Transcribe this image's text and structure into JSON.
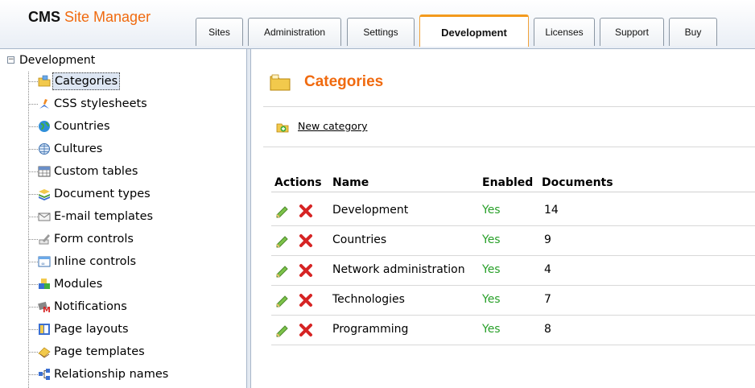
{
  "header": {
    "logo_primary": "CMS",
    "logo_secondary": "Site Manager",
    "tabs": [
      {
        "label": "Sites"
      },
      {
        "label": "Administration"
      },
      {
        "label": "Settings"
      },
      {
        "label": "Development",
        "active": true
      },
      {
        "label": "Licenses"
      },
      {
        "label": "Support"
      },
      {
        "label": "Buy"
      }
    ]
  },
  "tree": {
    "root_label": "Development",
    "items": [
      {
        "label": "Categories",
        "icon": "folder-categories-icon",
        "selected": true
      },
      {
        "label": "CSS stylesheets",
        "icon": "css-brush-icon"
      },
      {
        "label": "Countries",
        "icon": "globe-icon"
      },
      {
        "label": "Cultures",
        "icon": "world-culture-icon"
      },
      {
        "label": "Custom tables",
        "icon": "table-icon"
      },
      {
        "label": "Document types",
        "icon": "document-stack-icon"
      },
      {
        "label": "E-mail templates",
        "icon": "envelope-icon"
      },
      {
        "label": "Form controls",
        "icon": "form-pencil-icon"
      },
      {
        "label": "Inline controls",
        "icon": "inline-window-icon"
      },
      {
        "label": "Modules",
        "icon": "blocks-icon"
      },
      {
        "label": "Notifications",
        "icon": "notification-icon"
      },
      {
        "label": "Page layouts",
        "icon": "layout-icon"
      },
      {
        "label": "Page templates",
        "icon": "page-template-icon"
      },
      {
        "label": "Relationship names",
        "icon": "relationship-icon"
      }
    ]
  },
  "main": {
    "title": "Categories",
    "new_category_label": "New category",
    "columns": [
      "Actions",
      "Name",
      "Enabled",
      "Documents"
    ],
    "rows": [
      {
        "name": "Development",
        "enabled": "Yes",
        "documents": "14"
      },
      {
        "name": "Countries",
        "enabled": "Yes",
        "documents": "9"
      },
      {
        "name": "Network administration",
        "enabled": "Yes",
        "documents": "4"
      },
      {
        "name": "Technologies",
        "enabled": "Yes",
        "documents": "7"
      },
      {
        "name": "Programming",
        "enabled": "Yes",
        "documents": "8"
      }
    ]
  },
  "colors": {
    "accent": "#f06a0f",
    "enabled_green": "#29a02a",
    "active_tab_border": "#f39a1d"
  }
}
